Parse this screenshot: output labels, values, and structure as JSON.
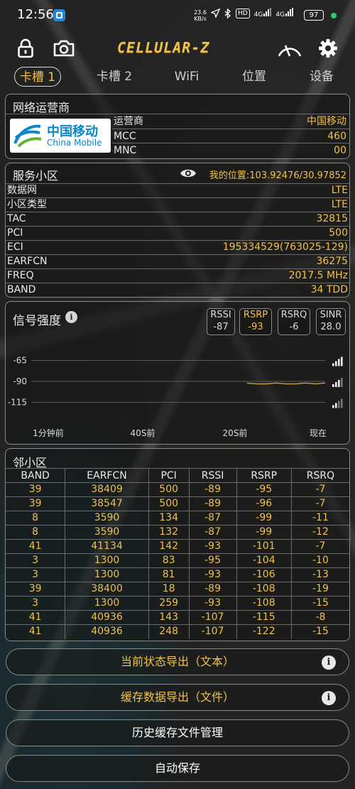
{
  "status": {
    "time": "12:56",
    "speed_top": "23.6",
    "speed_bottom": "KB/s",
    "hd": "HD",
    "net1": "4G",
    "net2": "4G",
    "battery": "97"
  },
  "toolbar": {
    "logo": "CELLULAR-Z"
  },
  "tabs": [
    "卡槽 1",
    "卡槽 2",
    "WiFi",
    "位置",
    "设备"
  ],
  "operator": {
    "title": "网络运营商",
    "logo_cn": "中国移动",
    "logo_en": "China Mobile",
    "rows": [
      {
        "k": "运营商",
        "v": "中国移动"
      },
      {
        "k": "MCC",
        "v": "460"
      },
      {
        "k": "MNC",
        "v": "00"
      }
    ]
  },
  "serving": {
    "title": "服务小区",
    "location": "我的位置:103.92476/30.97852",
    "rows": [
      {
        "k": "数据网",
        "v": "LTE"
      },
      {
        "k": "小区类型",
        "v": "LTE"
      },
      {
        "k": "TAC",
        "v": "32815"
      },
      {
        "k": "PCI",
        "v": "500"
      },
      {
        "k": "ECI",
        "v": "195334529(763025-129)"
      },
      {
        "k": "EARFCN",
        "v": "36275"
      },
      {
        "k": "FREQ",
        "v": "2017.5 MHz"
      },
      {
        "k": "BAND",
        "v": "34 TDD"
      }
    ]
  },
  "signal": {
    "title": "信号强度",
    "metrics": [
      {
        "label": "RSSI",
        "value": "-87",
        "selected": false
      },
      {
        "label": "RSRP",
        "value": "-93",
        "selected": true
      },
      {
        "label": "RSRQ",
        "value": "-6",
        "selected": false
      },
      {
        "label": "SINR",
        "value": "28.0",
        "selected": false
      }
    ]
  },
  "chart_data": {
    "type": "line",
    "yticks": [
      -65,
      -90,
      -115
    ],
    "xticks": [
      "1分钟前",
      "40S前",
      "20S前",
      "现在"
    ],
    "ylim": [
      -140,
      -40
    ],
    "series": [
      {
        "color": "#c9a24a",
        "x": [
          -16,
          -14,
          -12,
          -10,
          -8,
          -6,
          -4,
          -2,
          0
        ],
        "y": [
          -92,
          -93,
          -93,
          -92,
          -93,
          -93,
          -92,
          -93,
          -92
        ]
      }
    ]
  },
  "neighbors": {
    "title": "邻小区",
    "columns": [
      "BAND",
      "EARFCN",
      "PCI",
      "RSSI",
      "RSRP",
      "RSRQ"
    ],
    "rows": [
      [
        "39",
        "38409",
        "500",
        "-89",
        "-95",
        "-7"
      ],
      [
        "39",
        "38547",
        "500",
        "-89",
        "-96",
        "-7"
      ],
      [
        "8",
        "3590",
        "134",
        "-87",
        "-99",
        "-11"
      ],
      [
        "8",
        "3590",
        "132",
        "-87",
        "-99",
        "-12"
      ],
      [
        "41",
        "41134",
        "142",
        "-93",
        "-101",
        "-7"
      ],
      [
        "3",
        "1300",
        "83",
        "-95",
        "-104",
        "-10"
      ],
      [
        "3",
        "1300",
        "81",
        "-93",
        "-106",
        "-13"
      ],
      [
        "39",
        "38400",
        "18",
        "-89",
        "-108",
        "-19"
      ],
      [
        "3",
        "1300",
        "259",
        "-93",
        "-108",
        "-15"
      ],
      [
        "41",
        "40936",
        "143",
        "-107",
        "-115",
        "-8"
      ],
      [
        "41",
        "40936",
        "248",
        "-107",
        "-122",
        "-15"
      ]
    ]
  },
  "buttons": {
    "export_text": "当前状态导出（文本）",
    "export_file": "缓存数据导出（文件）",
    "history": "历史缓存文件管理",
    "autosave": "自动保存",
    "info_glyph": "i"
  },
  "colors": {
    "accent": "#f0c24b",
    "border": "#8a8a8a"
  }
}
